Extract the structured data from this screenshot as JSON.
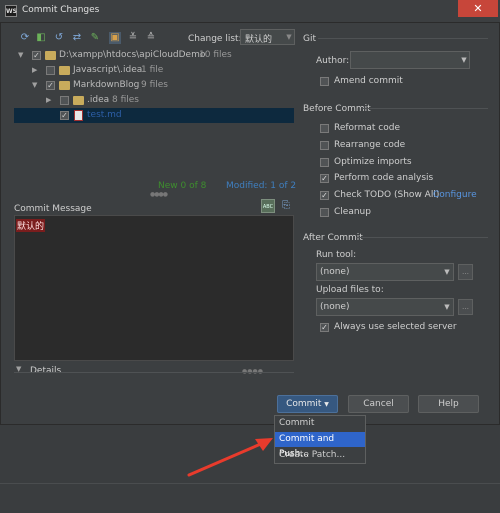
{
  "window": {
    "title": "Commit Changes",
    "app_icon": "WS"
  },
  "toolbar": {
    "icons": [
      "refresh-icon",
      "diff-icon",
      "revert-icon",
      "move-icon",
      "jump-icon",
      "group-icon",
      "expand-icon",
      "collapse-icon"
    ],
    "changelist_label": "Change list:",
    "changelist_value": "默认的"
  },
  "tree": {
    "rows": [
      {
        "name": "D:\\xampp\\htdocs\\apiCloudDemo",
        "sub": "10 files"
      },
      {
        "name": "Javascript\\.idea",
        "sub": "1 file"
      },
      {
        "name": "MarkdownBlog",
        "sub": "9 files"
      },
      {
        "name": ".idea",
        "sub": "8 files"
      },
      {
        "name": "test.md",
        "sub": ""
      }
    ]
  },
  "stats": {
    "new": "New 0 of 8",
    "modified": "Modified: 1 of 2"
  },
  "commit_message": {
    "label": "Commit Message",
    "text": "默认的"
  },
  "details": {
    "label": "Details"
  },
  "git": {
    "section": "Git",
    "author_label": "Author:",
    "author_value": "",
    "amend_label": "Amend commit"
  },
  "before_commit": {
    "section": "Before Commit",
    "options": [
      {
        "label": "Reformat code",
        "checked": false
      },
      {
        "label": "Rearrange code",
        "checked": false
      },
      {
        "label": "Optimize imports",
        "checked": false
      },
      {
        "label": "Perform code analysis",
        "checked": true
      },
      {
        "label": "Check TODO (Show All)",
        "checked": true
      },
      {
        "label": "Cleanup",
        "checked": false
      }
    ],
    "configure_link": "Configure"
  },
  "after_commit": {
    "section": "After Commit",
    "run_tool_label": "Run tool:",
    "run_tool_value": "(none)",
    "upload_label": "Upload files to:",
    "upload_value": "(none)",
    "always_use_label": "Always use selected server",
    "always_use_checked": true
  },
  "buttons": {
    "commit": "Commit",
    "cancel": "Cancel",
    "help": "Help"
  },
  "dropdown": {
    "items": [
      "Commit",
      "Commit and Push...",
      "Create Patch..."
    ],
    "highlighted_index": 1
  },
  "colors": {
    "accent": "#365880",
    "highlight": "#2f65ca",
    "link": "#5895e0",
    "new_files": "#3e8e2e",
    "modified_files": "#3f7fc0",
    "annotation_arrow": "#e83b2c"
  }
}
